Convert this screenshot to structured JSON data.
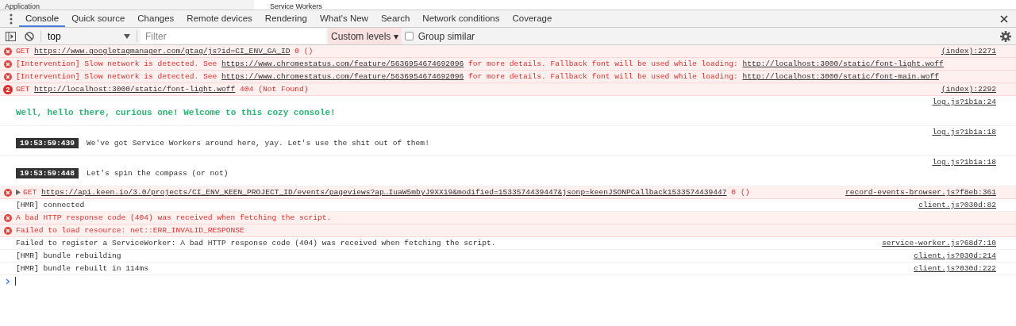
{
  "top_strip": {
    "left_title": "Application",
    "right_title": "Service Workers"
  },
  "tabs": [
    {
      "label": "Console",
      "selected": true
    },
    {
      "label": "Quick source",
      "selected": false
    },
    {
      "label": "Changes",
      "selected": false
    },
    {
      "label": "Remote devices",
      "selected": false
    },
    {
      "label": "Rendering",
      "selected": false
    },
    {
      "label": "What's New",
      "selected": false
    },
    {
      "label": "Search",
      "selected": false
    },
    {
      "label": "Network conditions",
      "selected": false
    },
    {
      "label": "Coverage",
      "selected": false
    }
  ],
  "toolbar": {
    "context": "top",
    "filter": {
      "placeholder": "Filter"
    },
    "levels": "Custom levels ▾",
    "group_similar": {
      "label": "Group similar",
      "checked": false
    }
  },
  "messages": [
    {
      "kind": "error",
      "parts": [
        {
          "text": "GET "
        },
        {
          "text": "https://www.googletagmanager.com/gtag/js?id=CI_ENV_GA_ID",
          "link": true
        },
        {
          "text": " 0 ()"
        }
      ],
      "source": "(index):2271"
    },
    {
      "kind": "error",
      "parts": [
        {
          "text": "[Intervention] Slow network is detected. See "
        },
        {
          "text": "https://www.chromestatus.com/feature/5636954674692096",
          "link": true
        },
        {
          "text": " for more details. Fallback font will be used while loading: "
        },
        {
          "text": "http://localhost:3000/static/font-light.woff",
          "link": true
        }
      ]
    },
    {
      "kind": "error",
      "parts": [
        {
          "text": "[Intervention] Slow network is detected. See "
        },
        {
          "text": "https://www.chromestatus.com/feature/5636954674692096",
          "link": true
        },
        {
          "text": " for more details. Fallback font will be used while loading: "
        },
        {
          "text": "http://localhost:3000/static/font-main.woff",
          "link": true
        }
      ]
    },
    {
      "kind": "error",
      "count": "2",
      "parts": [
        {
          "text": "GET "
        },
        {
          "text": "http://localhost:3000/static/font-light.woff",
          "link": true
        },
        {
          "text": " 404 (Not Found)"
        }
      ],
      "source": "(index):2292"
    },
    {
      "kind": "styled",
      "parts": [
        {
          "text": "Well, hello there, curious one! Welcome to this cozy console!"
        }
      ],
      "source": "log.js?1b1a:24"
    },
    {
      "kind": "timed",
      "time": "19:53:59:439",
      "parts": [
        {
          "text": "We've got Service Workers around here, yay. Let's use the shit out of them!"
        }
      ],
      "source": "log.js?1b1a:18"
    },
    {
      "kind": "timed",
      "time": "19:53:59:448",
      "parts": [
        {
          "text": "Let's spin the compass (or not)"
        }
      ],
      "source": "log.js?1b1a:18"
    },
    {
      "kind": "error",
      "expanded": false,
      "parts": [
        {
          "text": "GET "
        },
        {
          "text": "https://api.keen.io/3.0/projects/CI_ENV_KEEN_PROJECT_ID/events/pageviews?ap…IuaW5mbyJ9XX19&modified=1533574439447&jsonp=keenJSONPCallback1533574439447",
          "link": true
        },
        {
          "text": " 0 ()"
        }
      ],
      "source": "record-events-browser.js?f8eb:361"
    },
    {
      "kind": "log",
      "parts": [
        {
          "text": "[HMR] connected"
        }
      ],
      "source": "client.js?030d:82"
    },
    {
      "kind": "error",
      "parts": [
        {
          "text": "A bad HTTP response code (404) was received when fetching the script."
        }
      ]
    },
    {
      "kind": "error",
      "parts": [
        {
          "text": "Failed to load resource: net::ERR_INVALID_RESPONSE"
        }
      ]
    },
    {
      "kind": "log",
      "parts": [
        {
          "text": "Failed to register a ServiceWorker: A bad HTTP response code (404) was received when fetching the script."
        }
      ],
      "source": "service-worker.js?68d7:10"
    },
    {
      "kind": "log",
      "parts": [
        {
          "text": "[HMR] bundle rebuilding"
        }
      ],
      "source": "client.js?030d:214"
    },
    {
      "kind": "log",
      "parts": [
        {
          "text": "[HMR] bundle rebuilt in 114ms"
        }
      ],
      "source": "client.js?030d:222"
    }
  ]
}
